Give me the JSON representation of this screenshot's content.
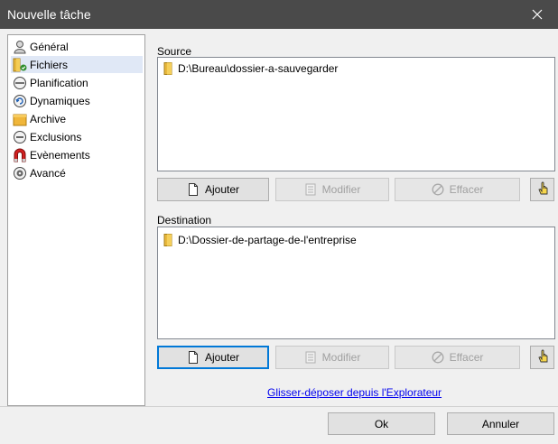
{
  "window": {
    "title": "Nouvelle tâche"
  },
  "sidebar": {
    "items": [
      {
        "label": "Général",
        "icon": "user-icon"
      },
      {
        "label": "Fichiers",
        "icon": "folder-icon",
        "selected": true
      },
      {
        "label": "Planification",
        "icon": "clock-icon"
      },
      {
        "label": "Dynamiques",
        "icon": "refresh-icon"
      },
      {
        "label": "Archive",
        "icon": "archive-folder-icon"
      },
      {
        "label": "Exclusions",
        "icon": "minus-circle-icon"
      },
      {
        "label": "Evènements",
        "icon": "magnet-icon"
      },
      {
        "label": "Avancé",
        "icon": "gear-icon"
      }
    ]
  },
  "source": {
    "label": "Source",
    "items": [
      "D:\\Bureau\\dossier-a-sauvegarder"
    ],
    "buttons": {
      "add": "Ajouter",
      "modify": "Modifier",
      "delete": "Effacer"
    }
  },
  "destination": {
    "label": "Destination",
    "items": [
      "D:\\Dossier-de-partage-de-l'entreprise"
    ],
    "buttons": {
      "add": "Ajouter",
      "modify": "Modifier",
      "delete": "Effacer"
    }
  },
  "drag_drop_link": "Glisser-déposer depuis l'Explorateur",
  "footer": {
    "ok": "Ok",
    "cancel": "Annuler"
  }
}
